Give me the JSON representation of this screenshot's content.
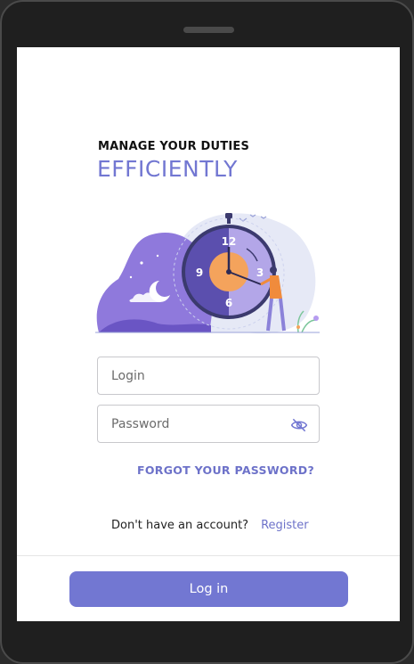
{
  "headline": {
    "small": "MANAGE YOUR DUTIES",
    "big": "EFFICIENTLY"
  },
  "illustration": {
    "clock_numbers": [
      "12",
      "3",
      "6",
      "9"
    ]
  },
  "login_field": {
    "placeholder": "Login",
    "value": ""
  },
  "password_field": {
    "placeholder": "Password",
    "value": "",
    "icon": "eye-off-icon"
  },
  "forgot_password": "FORGOT YOUR PASSWORD?",
  "register": {
    "question": "Don't have an account?",
    "link": "Register"
  },
  "login_button": "Log in",
  "colors": {
    "accent": "#7277d2",
    "link": "#6d72c9",
    "field_border": "#c8c8cc"
  }
}
